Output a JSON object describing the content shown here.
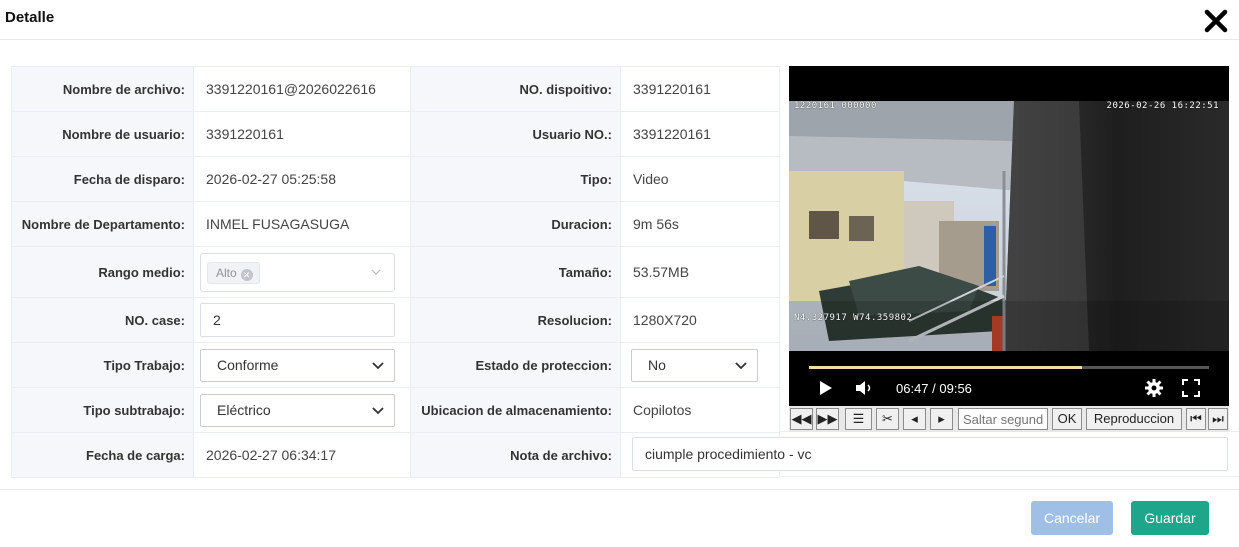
{
  "modal": {
    "title": "Detalle",
    "close_icon": "close-icon"
  },
  "fields": {
    "file_name": {
      "label": "Nombre de archivo:",
      "value": "3391220161@2026022616"
    },
    "device_no": {
      "label": "NO. dispoitivo:",
      "value": "3391220161"
    },
    "user_name": {
      "label": "Nombre de usuario:",
      "value": "3391220161"
    },
    "user_no": {
      "label": "Usuario NO.:",
      "value": "3391220161"
    },
    "trigger_date": {
      "label": "Fecha de disparo:",
      "value": "2026-02-27 05:25:58"
    },
    "type": {
      "label": "Tipo:",
      "value": "Video"
    },
    "department": {
      "label": "Nombre de Departamento:",
      "value": "INMEL FUSAGASUGA"
    },
    "duration": {
      "label": "Duracion:",
      "value": "9m 56s"
    },
    "media_range": {
      "label": "Rango medio:",
      "tag": "Alto"
    },
    "size": {
      "label": "Tamaño:",
      "value": "53.57MB"
    },
    "case_no": {
      "label": "NO. case:",
      "value": "2"
    },
    "resolution": {
      "label": "Resolucion:",
      "value": "1280X720"
    },
    "work_type": {
      "label": "Tipo Trabajo:",
      "value": "Conforme"
    },
    "protection_state": {
      "label": "Estado de proteccion:",
      "value": "No"
    },
    "work_subtype": {
      "label": "Tipo subtrabajo:",
      "value": "Eléctrico"
    },
    "storage_location": {
      "label": "Ubicacion de almacenamiento:",
      "value": "Copilotos"
    },
    "upload_date": {
      "label": "Fecha de carga:",
      "value": "2026-02-27 06:34:17"
    },
    "file_note": {
      "label": "Nota de archivo:",
      "value": "ciumple procedimiento - vc"
    }
  },
  "player": {
    "osd_left": "1220161 000000",
    "osd_right": "2026-02-26 16:22:51",
    "osd_gps": "N4.327917 W74.359802",
    "time": "06:47 / 09:56",
    "progress": 0.683
  },
  "toolbar": {
    "skip_placeholder": "Saltar segundos",
    "ok_label": "OK",
    "playback_label": "Reproduccion"
  },
  "footer": {
    "cancel_label": "Cancelar",
    "save_label": "Guardar"
  },
  "colors": {
    "save": "#1fa589",
    "cancel": "#a0bfe6",
    "progress": "#f1dcb1"
  }
}
